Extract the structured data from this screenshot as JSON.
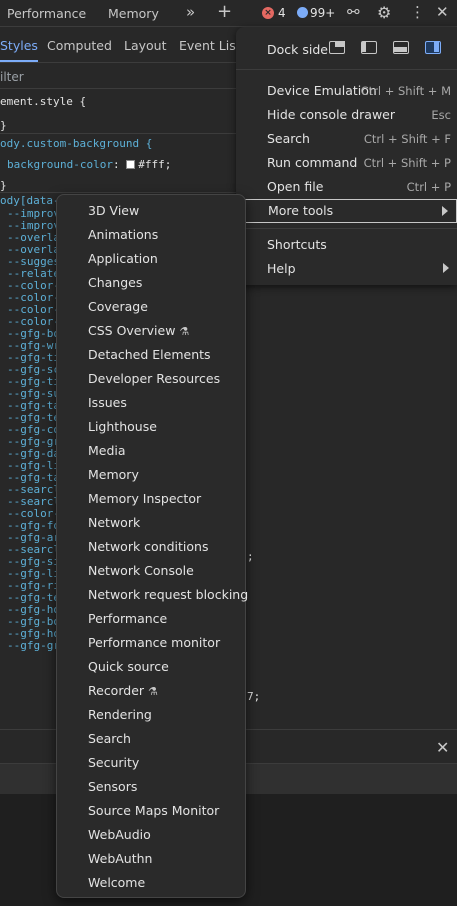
{
  "topbar": {
    "tabs": [
      "Performance",
      "Memory"
    ],
    "more_tabs_icon": "double-chevron-right-icon",
    "add_icon": "plus-icon",
    "error_count": "4",
    "message_count": "99+",
    "icons": [
      "error-icon",
      "message-icon",
      "customize-icon",
      "settings-gear-icon",
      "kebab-menu-icon",
      "close-icon"
    ]
  },
  "subtabs": [
    "Styles",
    "Computed",
    "Layout",
    "Event Liste"
  ],
  "filter": {
    "placeholder": "ilter"
  },
  "code": {
    "element_style": "ement.style {",
    "close_brace": "}",
    "custom_bg_selector": "ody.custom-background {",
    "custom_bg_prop": "background-color",
    "custom_bg_value": "#fff;",
    "data_selector": "ody[data-",
    "vars": [
      "--improv",
      "--improv",
      "--overla",
      "--overla",
      "--sugges",
      "--relate",
      "--color-",
      "--color-",
      "--color-",
      "--color-",
      "--gfg-bo",
      "--gfg-wr",
      "--gfg-ti",
      "--gfg-sc",
      "--gfg-ti",
      "--gfg-su",
      "--gfg-ta",
      "--gfg-te",
      "--gfg-co",
      "--gfg-gr",
      "--gfg-da",
      "--gfg-li",
      "--gfg-ta",
      "--searcl",
      "--searcl",
      "--color-",
      "--gfg-fo",
      "--gfg-ar",
      "--searcl",
      "--gfg-si",
      "--gfg-li",
      "--gfg-ri",
      "--gfg-te",
      "--gfg-ho",
      "--gfg-bo",
      "--gfg-ho",
      "--gfg-gr"
    ],
    "trailing_semicolon": ";",
    "trailing_seven": "7;"
  },
  "main_menu": {
    "dock_side_label": "Dock side",
    "items": [
      {
        "label": "Device Emulation",
        "shortcut": "Ctrl + Shift + M"
      },
      {
        "label": "Hide console drawer",
        "shortcut": "Esc"
      },
      {
        "label": "Search",
        "shortcut": "Ctrl + Shift + F"
      },
      {
        "label": "Run command",
        "shortcut": "Ctrl + Shift + P"
      },
      {
        "label": "Open file",
        "shortcut": "Ctrl + P"
      },
      {
        "label": "More tools",
        "shortcut": ""
      },
      {
        "label": "Shortcuts",
        "shortcut": ""
      },
      {
        "label": "Help",
        "shortcut": ""
      }
    ]
  },
  "more_tools": [
    "3D View",
    "Animations",
    "Application",
    "Changes",
    "Coverage",
    "CSS Overview",
    "Detached Elements",
    "Developer Resources",
    "Issues",
    "Lighthouse",
    "Media",
    "Memory",
    "Memory Inspector",
    "Network",
    "Network conditions",
    "Network Console",
    "Network request blocking",
    "Performance",
    "Performance monitor",
    "Quick source",
    "Recorder",
    "Rendering",
    "Search",
    "Security",
    "Sensors",
    "Source Maps Monitor",
    "WebAudio",
    "WebAuthn",
    "Welcome"
  ],
  "colors": {
    "accent": "#7cacf8",
    "error": "#e46962",
    "menu_bg": "#2a2a2a",
    "panel_bg": "#282828"
  }
}
